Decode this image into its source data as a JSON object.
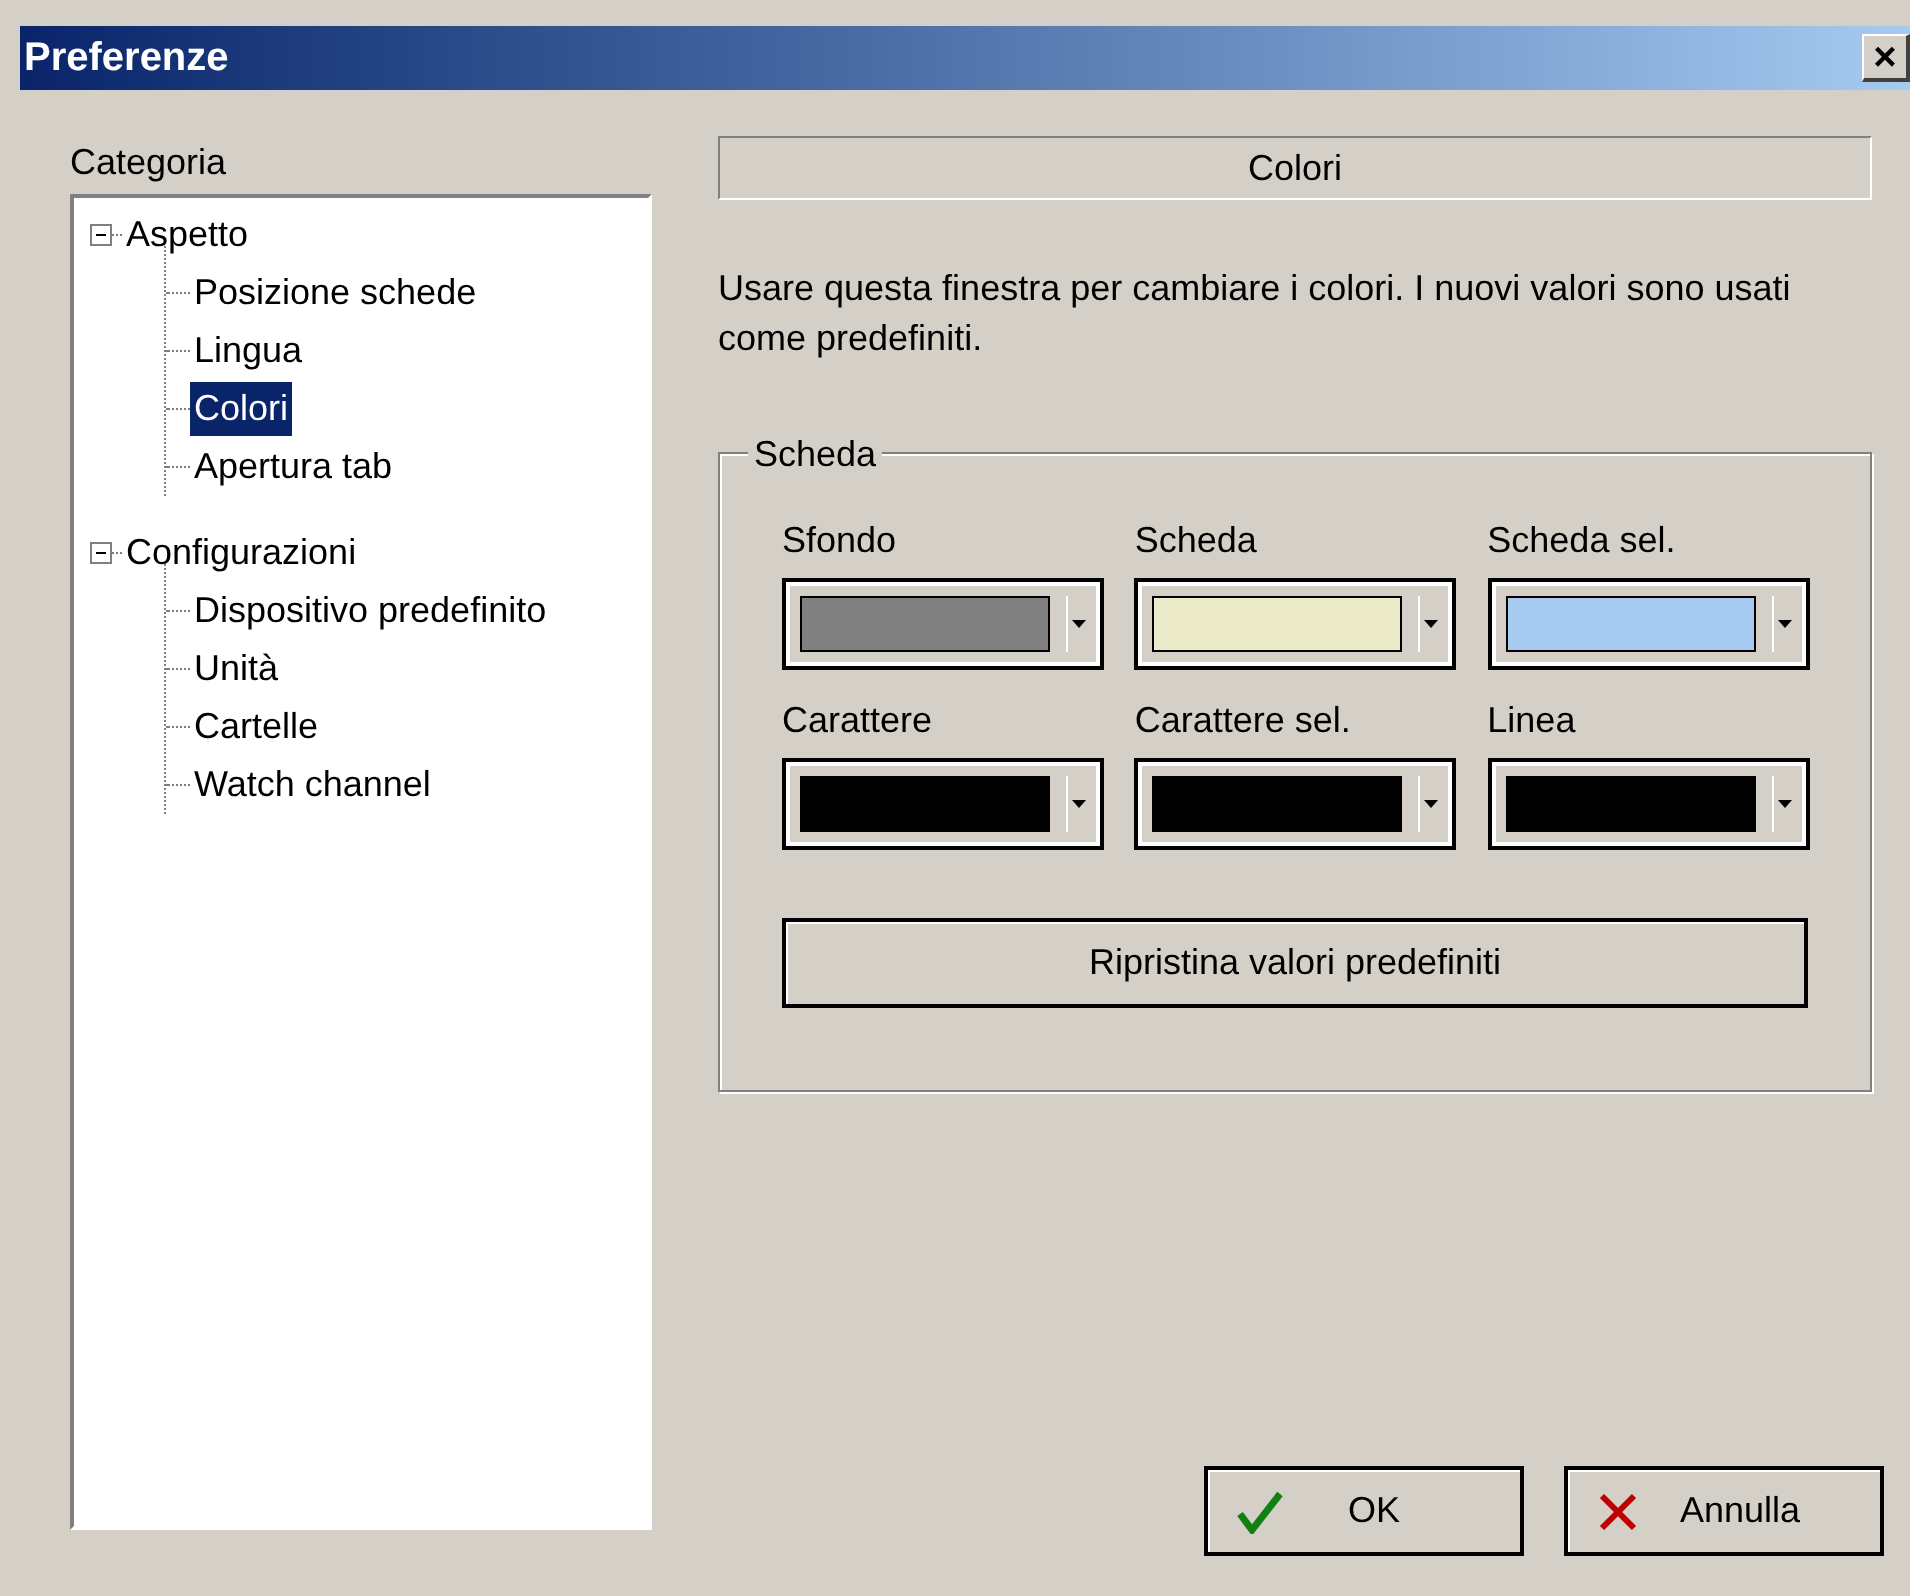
{
  "window": {
    "title": "Preferenze",
    "close": "×"
  },
  "category_label": "Categoria",
  "tree": [
    {
      "label": "Aspetto",
      "expanded": true,
      "selected": false,
      "children": [
        {
          "label": "Posizione schede",
          "selected": false
        },
        {
          "label": "Lingua",
          "selected": false
        },
        {
          "label": "Colori",
          "selected": true
        },
        {
          "label": "Apertura tab",
          "selected": false
        }
      ]
    },
    {
      "label": "Configurazioni",
      "expanded": true,
      "selected": false,
      "children": [
        {
          "label": "Dispositivo predefinito",
          "selected": false
        },
        {
          "label": "Unità",
          "selected": false
        },
        {
          "label": "Cartelle",
          "selected": false
        },
        {
          "label": "Watch channel",
          "selected": false
        }
      ]
    }
  ],
  "panel_title": "Colori",
  "description": "Usare questa finestra per cambiare i colori. I nuovi valori sono usati come predefiniti.",
  "group": {
    "title": "Scheda",
    "colors": [
      {
        "label": "Sfondo",
        "color": "#808080"
      },
      {
        "label": "Scheda",
        "color": "#ecebc9"
      },
      {
        "label": "Scheda sel.",
        "color": "#a6caf0"
      },
      {
        "label": "Carattere",
        "color": "#000000"
      },
      {
        "label": "Carattere sel.",
        "color": "#000000"
      },
      {
        "label": "Linea",
        "color": "#000000"
      }
    ],
    "reset_button": "Ripristina valori predefiniti"
  },
  "buttons": [
    {
      "label": "OK",
      "kind": "ok"
    },
    {
      "label": "Annulla",
      "kind": "cancel"
    }
  ]
}
